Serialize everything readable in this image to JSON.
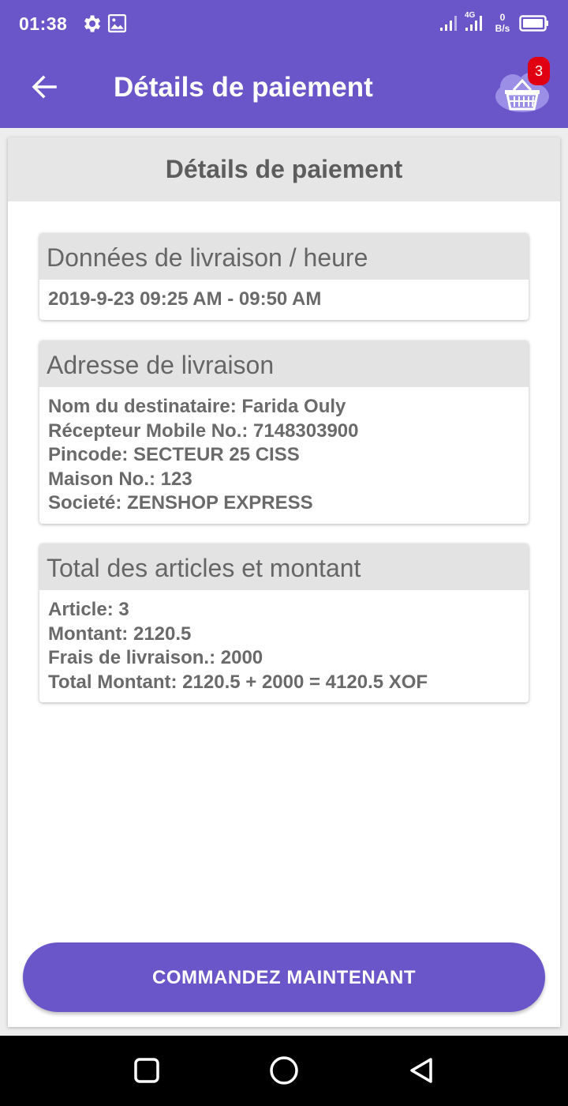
{
  "status_bar": {
    "time": "01:38",
    "network": "4G",
    "speed_value": "0",
    "speed_unit": "B/s",
    "icons": [
      "gear-icon",
      "image-icon",
      "signal-icon",
      "signal-icon",
      "battery-icon"
    ]
  },
  "app_bar": {
    "title": "Détails de paiement",
    "cart_count": "3",
    "icons": [
      "back-arrow-icon",
      "basket-icon"
    ]
  },
  "page": {
    "header": "Détails de paiement",
    "delivery_time": {
      "title": "Données de livraison / heure",
      "value": "2019-9-23 09:25 AM - 09:50 AM"
    },
    "address": {
      "title": "Adresse de livraison",
      "lines": [
        "Nom du destinataire: Farida Ouly",
        "Récepteur Mobile No.: 7148303900",
        "Pincode: SECTEUR 25 CISS",
        "Maison No.: 123",
        "Societé: ZENSHOP EXPRESS"
      ]
    },
    "totals": {
      "title": "Total des articles et montant",
      "lines": [
        "Article: 3",
        "Montant: 2120.5",
        "Frais de livraison.: 2000",
        "Total Montant: 2120.5 + 2000 = 4120.5 XOF"
      ]
    },
    "order_button": "COMMANDEZ MAINTENANT"
  },
  "nav_bar": {
    "icons": [
      "recents-icon",
      "home-icon",
      "back-icon"
    ]
  },
  "colors": {
    "primary": "#6a55c9",
    "badge": "#e00012",
    "section_header_bg": "#e3e3e3",
    "text": "#6a6a6a"
  }
}
